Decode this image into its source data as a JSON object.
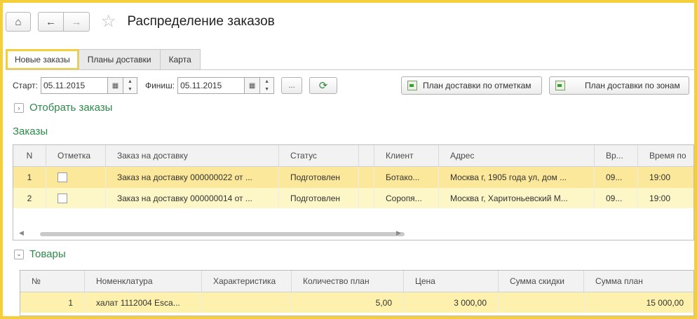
{
  "header": {
    "title": "Распределение заказов"
  },
  "tabs": [
    {
      "label": "Новые заказы",
      "active": true
    },
    {
      "label": "Планы доставки",
      "active": false
    },
    {
      "label": "Карта",
      "active": false
    }
  ],
  "filter": {
    "start_label": "Старт:",
    "start_value": "05.11.2015",
    "finish_label": "Финиш:",
    "finish_value": "05.11.2015",
    "ellipsis_label": "..."
  },
  "buttons": {
    "plan_by_marks": "План доставки по отметкам",
    "plan_by_zones": "План доставки по зонам"
  },
  "select_orders": {
    "label": "Отобрать заказы"
  },
  "orders": {
    "title": "Заказы",
    "columns": [
      "N",
      "Отметка",
      "Заказ на доставку",
      "Статус",
      "",
      "Клиент",
      "Адрес",
      "Вр...",
      "Время по"
    ],
    "rows": [
      {
        "n": "1",
        "order": "Заказ на доставку 000000022 от ...",
        "status": "Подготовлен",
        "client": "Ботако...",
        "address": "Москва г, 1905 года ул, дом ...",
        "time_from": "09...",
        "time_to": "19:00"
      },
      {
        "n": "2",
        "order": "Заказ на доставку 000000014 от ...",
        "status": "Подготовлен",
        "client": "Соропя...",
        "address": "Москва г, Харитоньевский М...",
        "time_from": "09...",
        "time_to": "19:00"
      }
    ]
  },
  "goods": {
    "title": "Товары",
    "columns": [
      "№",
      "Номенклатура",
      "Характеристика",
      "Количество план",
      "Цена",
      "Сумма скидки",
      "Сумма план"
    ],
    "rows": [
      {
        "n": "1",
        "item": "халат 1112004 Esca...",
        "characteristic": "",
        "qty": "5,00",
        "price": "3 000,00",
        "discount": "",
        "sum": "15 000,00"
      }
    ]
  },
  "colors": {
    "highlight": "#f5cf3a",
    "accent_green": "#2b8a4a",
    "row_selected": "#fbe89a",
    "row_normal": "#fdf6c6"
  }
}
